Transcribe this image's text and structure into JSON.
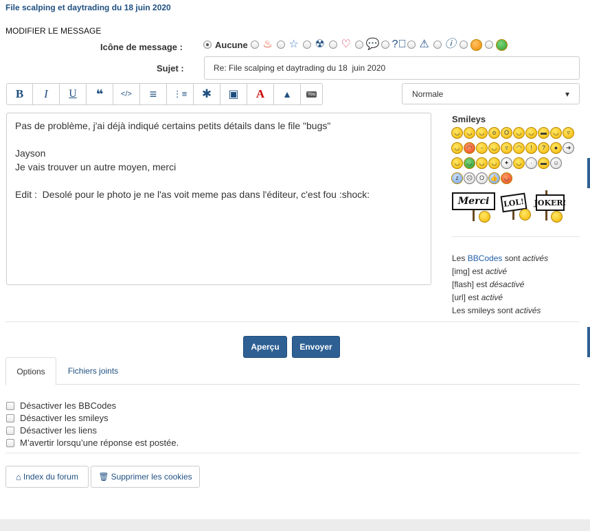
{
  "thread_title": "File scalping et daytrading du 18 juin 2020",
  "section_title": "MODIFIER LE MESSAGE",
  "icon_field": {
    "label": "Icône de message :",
    "none_label": "Aucune",
    "icons": [
      "fire-icon",
      "star-icon",
      "radioactive-icon",
      "heart-icon",
      "speech-bubble-icon",
      "question-icon",
      "warning-icon",
      "info-icon",
      "orange-smiley-icon",
      "green-smiley-icon"
    ]
  },
  "subject": {
    "label": "Sujet :",
    "value": "Re: File scalping et daytrading du 18  juin 2020"
  },
  "toolbar": {
    "bold": "B",
    "italic": "I",
    "underline": "U",
    "quote": "❝",
    "code": "</>",
    "list": "≡",
    "list_numbered": "⋮≡",
    "star": "✱",
    "image": "▣",
    "color": "A",
    "warning": "▲",
    "youtube": "You"
  },
  "font_size": {
    "selected": "Normale",
    "arrow": "▾"
  },
  "editor": {
    "content": "Pas de problème, j'ai déjà indiqué certains petits détails dans le file \"bugs\"\n\nJayson\nJe vais trouver un autre moyen, merci\n\nEdit :  Desolé pour le photo je ne l'as voit meme pas dans l'éditeur, c'est fou :shock:"
  },
  "smileys": {
    "title": "Smileys",
    "signs": {
      "merci": "Merci",
      "lol": "LOL!",
      "joker": "JOKER!"
    }
  },
  "bbcode_info": {
    "line1_prefix": "Les ",
    "line1_link": "BBCodes",
    "line1_mid": " sont ",
    "line1_state": "activés",
    "img_label": "[img] est ",
    "img_state": "activé",
    "flash_label": "[flash] est ",
    "flash_state": "désactivé",
    "url_label": "[url] est ",
    "url_state": "activé",
    "smileys_label": "Les smileys sont ",
    "smileys_state": "activés"
  },
  "buttons": {
    "preview": "Aperçu",
    "submit": "Envoyer"
  },
  "tabs": [
    "Options",
    "Fichiers joints"
  ],
  "options": [
    "Désactiver les BBCodes",
    "Désactiver les smileys",
    "Désactiver les liens",
    "M’avertir lorsqu’une réponse est postée."
  ],
  "footer_buttons": {
    "index": "Index du forum",
    "cookies": "Supprimer les cookies"
  }
}
